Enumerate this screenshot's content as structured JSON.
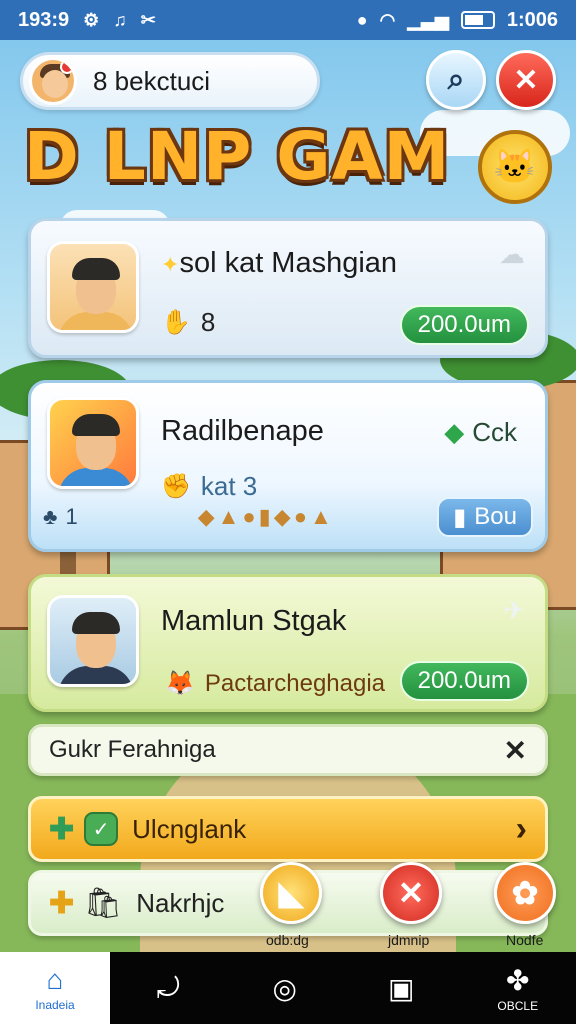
{
  "status_bar": {
    "time": "193:9",
    "clock": "1:006",
    "signal": "4G"
  },
  "header": {
    "profile_name": "8 bekctuci"
  },
  "title": {
    "text": "D LNP GAM"
  },
  "players": [
    {
      "name": "sol kat Mashgian",
      "stat": "8",
      "price": "200.0um"
    },
    {
      "name": "Radilbenape",
      "tag": "Cck",
      "stat": "kat 3",
      "count": "1",
      "buy_label": "Bou"
    },
    {
      "name": "Mamlun Stgak",
      "subtitle": "Pactarcheghagia",
      "price": "200.0um"
    }
  ],
  "notification": {
    "text": "Gukr Ferahniga"
  },
  "menu": [
    {
      "label": "Ulcnglank"
    },
    {
      "label": "Nakrhjc"
    }
  ],
  "fab_labels": [
    "odb:dg",
    "jdmnip",
    "Nodfe"
  ],
  "nav": [
    {
      "label": "Inadeia",
      "icon": "home-icon"
    },
    {
      "label": "",
      "icon": "link-icon"
    },
    {
      "label": "",
      "icon": "circle-icon"
    },
    {
      "label": "",
      "icon": "recents-icon"
    },
    {
      "label": "OBCLE",
      "icon": "puzzle-icon"
    }
  ],
  "colors": {
    "status_bar": "#2f6fb8",
    "price_green": "#24913f",
    "close_red": "#d8261b",
    "title_orange": "#ffb22a"
  }
}
